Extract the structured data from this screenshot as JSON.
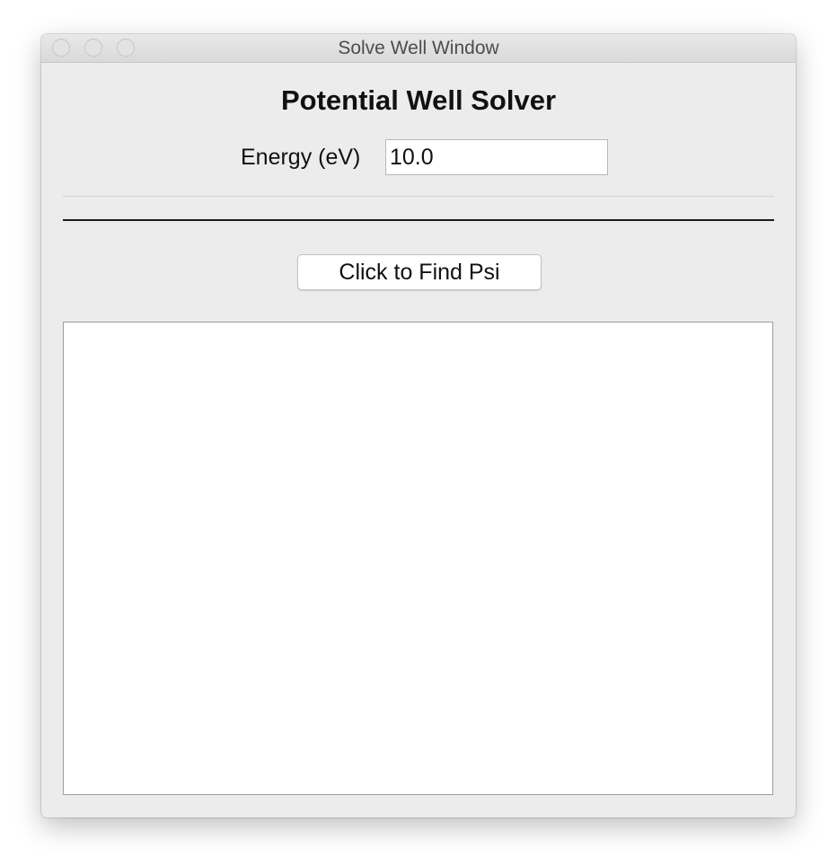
{
  "window": {
    "title": "Solve Well Window"
  },
  "app": {
    "heading": "Potential Well Solver"
  },
  "energy": {
    "label": "Energy (eV)",
    "value": "10.0"
  },
  "actions": {
    "find_psi_label": "Click to Find Psi"
  }
}
